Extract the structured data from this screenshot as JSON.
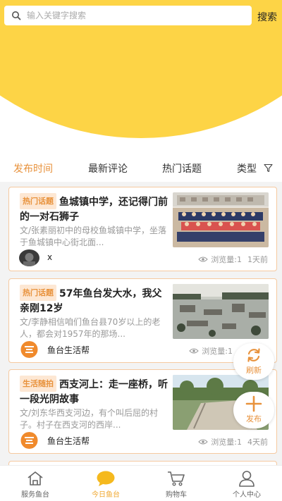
{
  "search": {
    "placeholder": "输入关键字搜索",
    "button": "搜索"
  },
  "tabs": [
    {
      "label": "发布时间",
      "active": true
    },
    {
      "label": "最新评论",
      "active": false
    },
    {
      "label": "热门话题",
      "active": false
    },
    {
      "label": "类型",
      "active": false
    }
  ],
  "colors": {
    "accent": "#e8923c",
    "brand_yellow": "#fdd446",
    "tag_bg": "#fde7d3",
    "card_border": "#f5c9a0"
  },
  "posts": [
    {
      "tag": "热门话题",
      "title": "鱼城镇中学，还记得门前的一对石狮子",
      "summary": "文/张素丽初中的母校鱼城镇中学，坐落于鱼城镇中心街北面...",
      "author": "x",
      "views_label": "浏览量:1",
      "time": "1天前"
    },
    {
      "tag": "热门话题",
      "title": "57年鱼台发大水，我父亲刚12岁",
      "summary": "文/李静相信咱们鱼台县70岁以上的老人，都会对1957年的那场...",
      "author": "鱼台生活帮",
      "views_label": "浏览量:1",
      "time": ""
    },
    {
      "tag": "生活随拍",
      "title": "西支河上：走一座桥，听一段光阴故事",
      "summary": "文/刘东华西支河边，有个叫后屈的村子。村子在西支河的西岸...",
      "author": "鱼台生活帮",
      "views_label": "浏览量:1",
      "time": "4天前"
    }
  ],
  "floating": {
    "refresh": "刷新",
    "publish": "发布"
  },
  "bottom_nav": [
    {
      "label": "服务鱼台",
      "icon": "home-icon",
      "active": false
    },
    {
      "label": "今日鱼台",
      "icon": "chat-bubble-icon",
      "active": true
    },
    {
      "label": "购物车",
      "icon": "cart-icon",
      "active": false
    },
    {
      "label": "个人中心",
      "icon": "person-icon",
      "active": false
    }
  ]
}
